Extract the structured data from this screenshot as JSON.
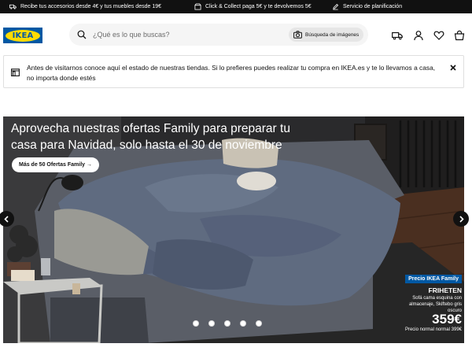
{
  "topbar": {
    "promo_1": "Recibe tus accesorios desde 4€ y tus muebles desde 19€",
    "promo_2": "Click & Collect paga 5€ y te devolvemos 5€",
    "promo_3": "Servicio de planificación"
  },
  "header": {
    "logo_text": "IKEA",
    "search_placeholder": "¿Qué es lo que buscas?",
    "image_search_label": "Búsqueda de imágenes",
    "icons": [
      "delivery-truck-icon",
      "user-icon",
      "heart-icon",
      "shopping-bag-icon"
    ]
  },
  "notice": {
    "text": "Antes de visitarnos conoce aquí el estado de nuestras tiendas. Si lo prefieres puedes realizar tu compra en IKEA.es y te lo llevamos a casa, no importa donde estés"
  },
  "hero": {
    "title": "Aprovecha nuestras ofertas Family para preparar tu casa para Navidad, solo hasta el 30 de noviembre",
    "button_label": "Más de 50 Ofertas Family →",
    "slide_count": 5,
    "active_slide": 0
  },
  "price_tag": {
    "badge": "Precio IKEA Family",
    "product_name": "FRIHETEN",
    "description": "Sofá cama esquina con almacenaje, Skiftebo gris oscuro",
    "price": "359€",
    "normal_price": "Precio normal normal 399€"
  },
  "colors": {
    "ikea_blue": "#0058a3",
    "ikea_yellow": "#ffdb00",
    "topbar_bg": "#111111"
  }
}
